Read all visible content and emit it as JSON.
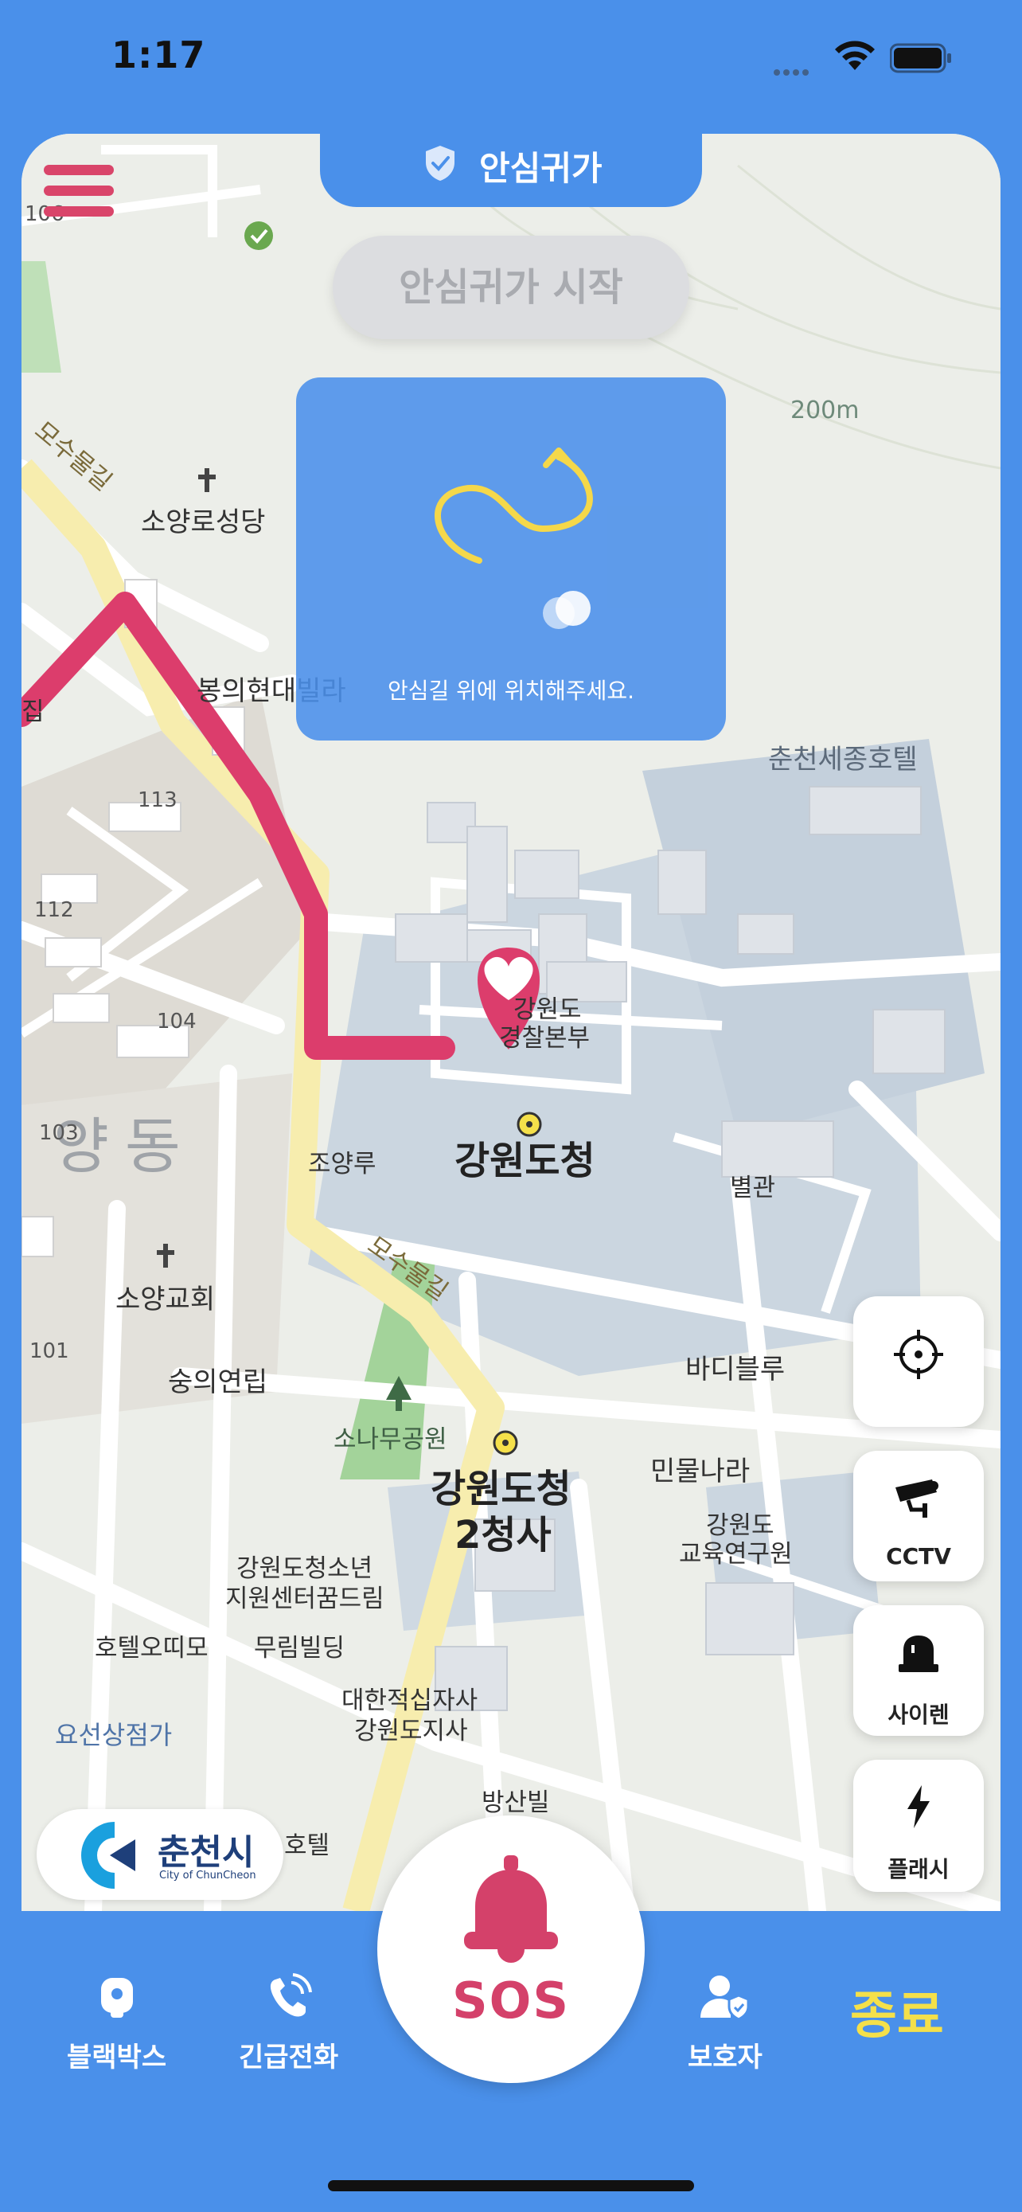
{
  "status_bar": {
    "time": "1:17"
  },
  "header": {
    "title": "안심귀가"
  },
  "start_button": {
    "label": "안심귀가 시작"
  },
  "guide": {
    "text": "안심길 위에 위치해주세요."
  },
  "map": {
    "scale_label": "200m",
    "labels": {
      "soyangro_cathedral": "소양로성당",
      "bongui_villa": "봉의현대빌라",
      "chuncheon_sejong_hotel": "춘천세종호텔",
      "gangwon_hq_1": "강원도",
      "gangwon_hq_2": "경찰본부",
      "gangwon_office": "강원도청",
      "soyangru": "조양루",
      "annex": "별관",
      "soyang_church": "소양교회",
      "sungui": "숭의연립",
      "badi_blue": "바디블루",
      "pine_park": "소나무공원",
      "folk_country": "민물나라",
      "gangwon_office_2_1": "강원도청",
      "gangwon_office_2_2": "2청사",
      "edu_institute_1": "강원도",
      "edu_institute_2": "교육연구원",
      "youth_center_1": "강원도청소년",
      "youth_center_2": "지원센터꿈드림",
      "hotel_otimo": "호텔오띠모",
      "murim_building": "무림빌딩",
      "red_cross_1": "대한적십자사",
      "red_cross_2": "강원도지사",
      "yoseon_shop": "요선상점가",
      "bangsan_villa": "방산빌",
      "hotel": "호텔",
      "yang_dong": "양동",
      "mosu_road_1": "모수물길",
      "mosu_road_2": "모수물길",
      "num_106": "106",
      "num_113": "113",
      "num_112": "112",
      "num_104": "104",
      "num_103": "103",
      "num_101": "101",
      "edge_jip": "집"
    }
  },
  "side_buttons": {
    "locate": {
      "icon": "crosshair-icon",
      "label": ""
    },
    "cctv": {
      "icon": "cctv-icon",
      "label": "CCTV"
    },
    "siren": {
      "icon": "siren-icon",
      "label": "사이렌"
    },
    "flash": {
      "icon": "flash-icon",
      "label": "플래시"
    }
  },
  "city_logo": {
    "name": "춘천시",
    "sub": "City of ChunCheon"
  },
  "bottom_nav": {
    "blackbox": "블랙박스",
    "emergency_call": "긴급전화",
    "sos": "SOS",
    "guardian": "보호자",
    "end": "종료"
  },
  "colors": {
    "primary_blue": "#4a90ea",
    "route_pink": "#dc3d6c",
    "end_yellow": "#f4e04a",
    "sos_red": "#d4416a"
  }
}
